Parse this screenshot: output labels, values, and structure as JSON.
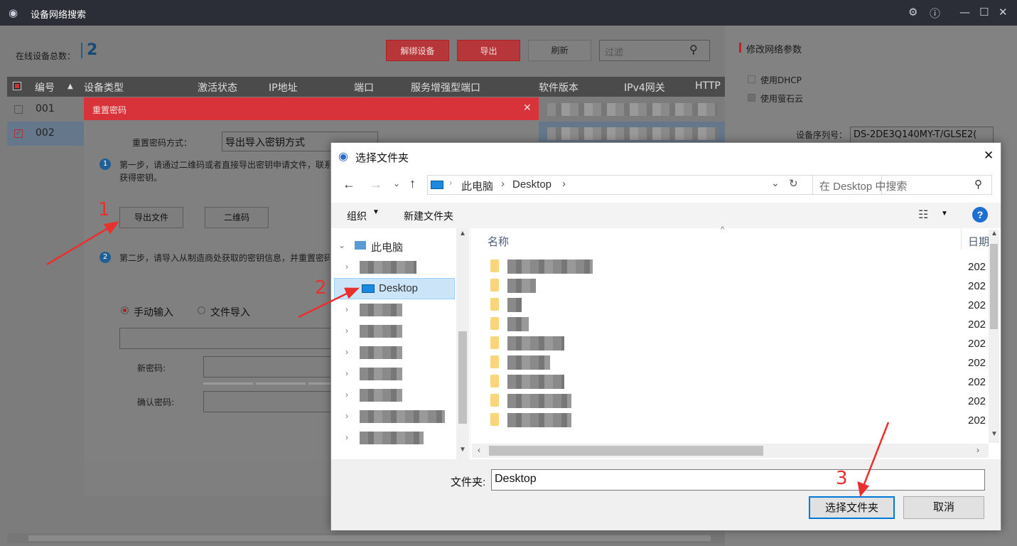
{
  "app": {
    "title": "设备网络搜索"
  },
  "toolbar": {
    "online_label": "在线设备总数：",
    "online_count": "2",
    "unbind": "解绑设备",
    "export": "导出",
    "refresh": "刷新",
    "filter_placeholder": "过滤"
  },
  "table": {
    "headers": [
      "编号",
      "设备类型",
      "激活状态",
      "IP地址",
      "端口",
      "服务增强型端口",
      "软件版本",
      "IPv4网关",
      "HTTP"
    ],
    "rows": [
      {
        "id": "001"
      },
      {
        "id": "002"
      }
    ]
  },
  "right": {
    "title": "修改网络参数",
    "dhcp": "使用DHCP",
    "ezviz": "使用萤石云",
    "serial_label": "设备序列号：",
    "serial": "DS-2DE3Q140MY-T/GLSE2("
  },
  "reset": {
    "title": "重置密码",
    "method_label": "重置密码方式：",
    "method_value": "导出导入密钥方式",
    "step1": "第一步，请通过二维码或者直接导出密钥申请文件，联系",
    "step1b": "获得密钥。",
    "export_file": "导出文件",
    "qr": "二维码",
    "step2": "第二步，请导入从制造商处获取的密钥信息，并重置密码",
    "manual": "手动输入",
    "file_import": "文件导入",
    "new_pwd": "新密码:",
    "confirm_pwd": "确认密码:"
  },
  "dialog": {
    "title": "选择文件夹",
    "path": [
      "此电脑",
      "Desktop"
    ],
    "search_placeholder": "在 Desktop 中搜索",
    "organize": "组织",
    "new_folder": "新建文件夹",
    "nav_root": "此电脑",
    "nav_desktop": "Desktop",
    "col_name": "名称",
    "col_date": "日期",
    "dates": [
      "202",
      "202",
      "202",
      "202",
      "202",
      "202",
      "202",
      "202",
      "202"
    ],
    "folder_label": "文件夹:",
    "folder_value": "Desktop",
    "select_btn": "选择文件夹",
    "cancel_btn": "取消"
  },
  "annotations": [
    "1",
    "2",
    "3"
  ]
}
